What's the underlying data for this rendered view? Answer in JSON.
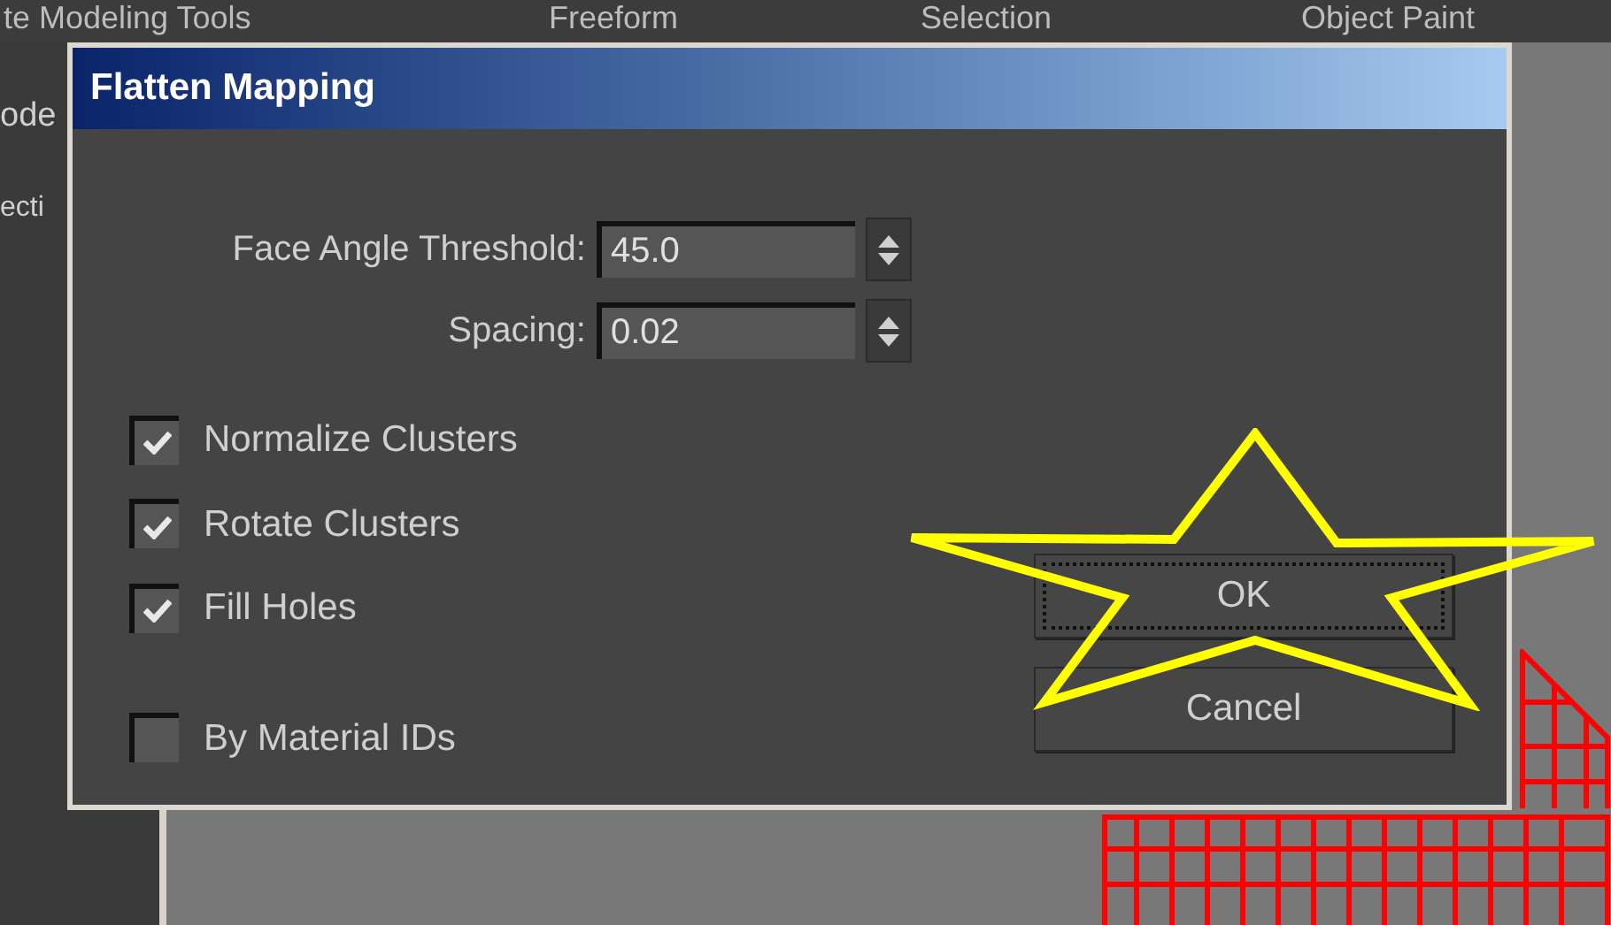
{
  "background": {
    "ribbon_tabs": [
      "te Modeling Tools",
      "Freeform",
      "Selection",
      "Object Paint"
    ],
    "side_labels": [
      "ode",
      "ecti"
    ]
  },
  "dialog": {
    "title": "Flatten Mapping",
    "fields": [
      {
        "label": "Face Angle Threshold:",
        "value": "45.0"
      },
      {
        "label": "Spacing:",
        "value": "0.02"
      }
    ],
    "checkboxes": [
      {
        "label": "Normalize Clusters",
        "checked": true
      },
      {
        "label": "Rotate Clusters",
        "checked": true
      },
      {
        "label": "Fill Holes",
        "checked": true
      },
      {
        "label": "By Material IDs",
        "checked": false
      }
    ],
    "buttons": [
      {
        "label": "OK",
        "focused": true
      },
      {
        "label": "Cancel",
        "focused": false
      }
    ]
  }
}
